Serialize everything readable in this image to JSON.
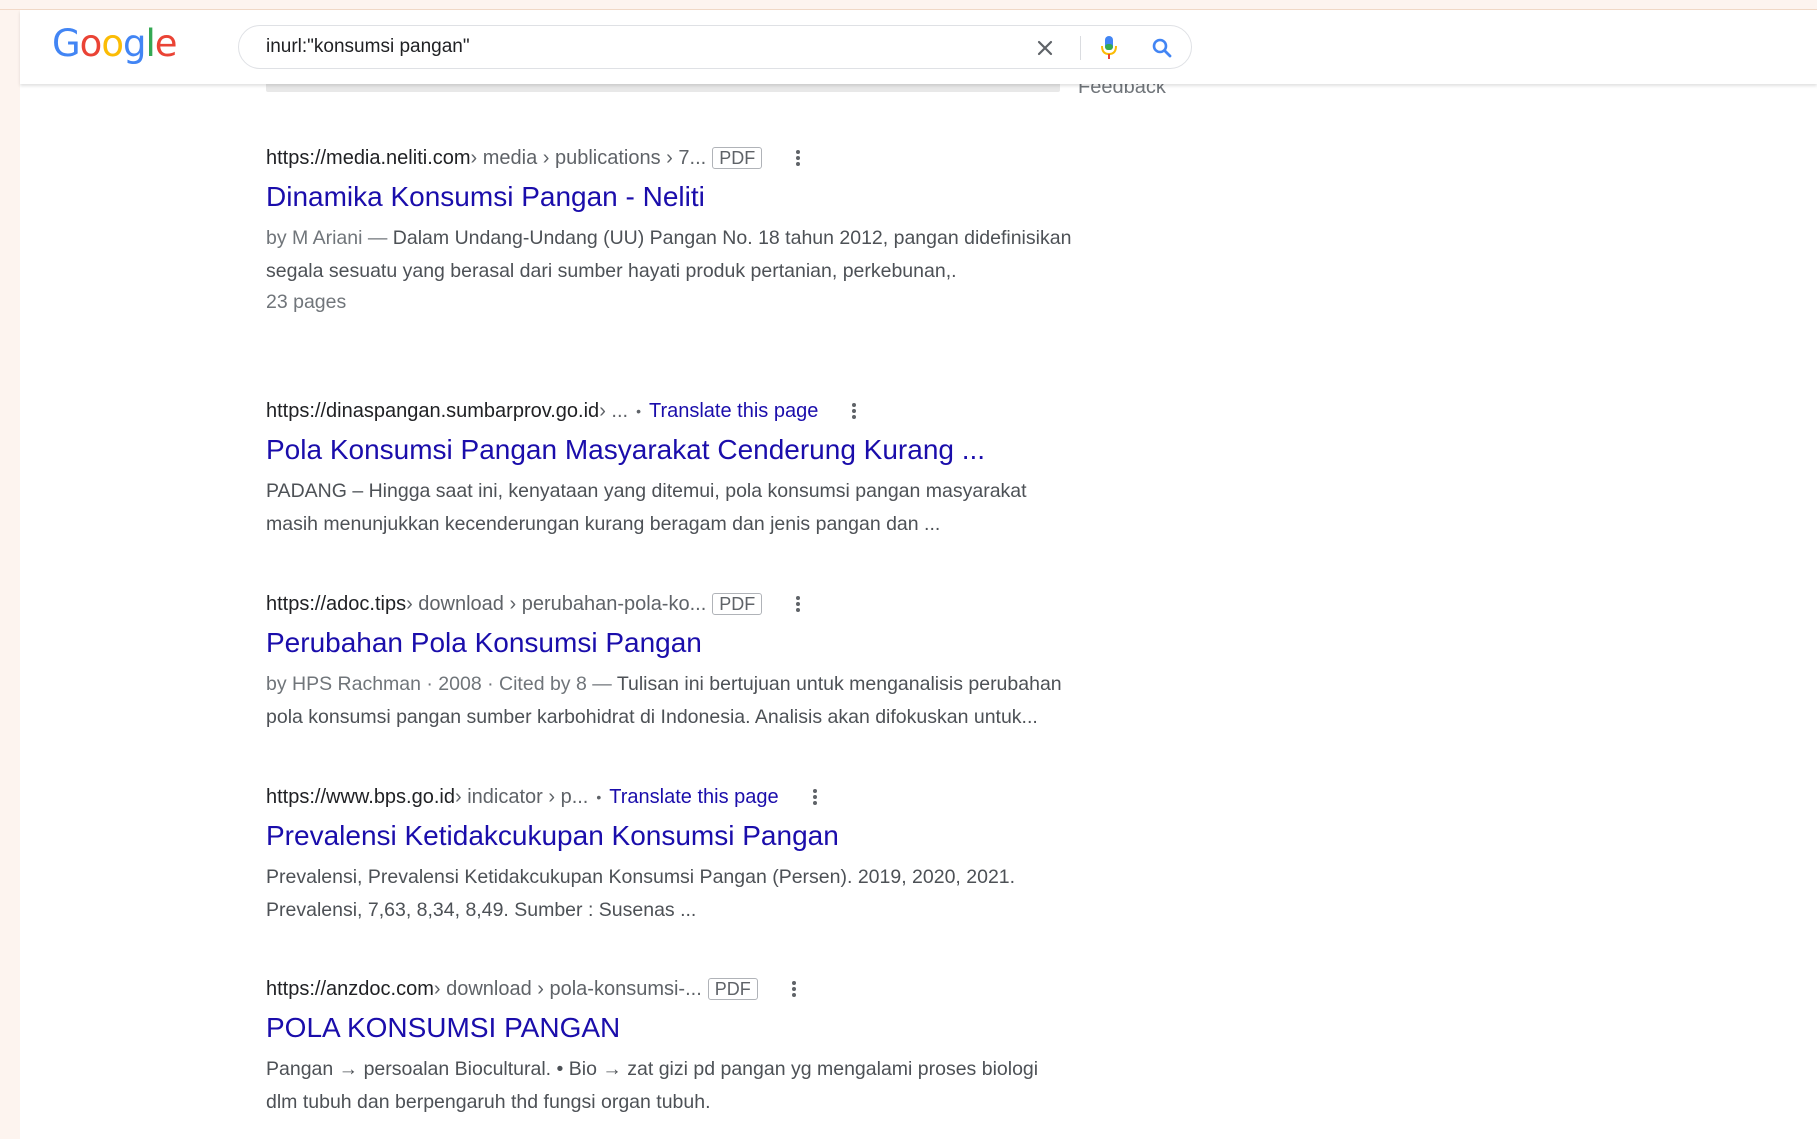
{
  "header": {
    "logo_letters": [
      {
        "ch": "G",
        "color": "#4285f4"
      },
      {
        "ch": "o",
        "color": "#ea4335"
      },
      {
        "ch": "o",
        "color": "#fbbc05"
      },
      {
        "ch": "g",
        "color": "#4285f4"
      },
      {
        "ch": "l",
        "color": "#34a853"
      },
      {
        "ch": "e",
        "color": "#ea4335"
      }
    ],
    "search_value": "inurl:\"konsumsi pangan\"",
    "icons": {
      "clear": "close-icon",
      "mic": "mic-icon",
      "search": "search-icon"
    }
  },
  "feedback_label": "Feedback",
  "results": [
    {
      "site": "https://media.neliti.com",
      "path": " › media › publications › 7...",
      "pdf": "PDF",
      "title": "Dinamika Konsumsi Pangan - Neliti",
      "meta": "by M Ariani — ",
      "snippet1": "Dalam Undang-Undang (UU) Pangan No. 18 tahun 2012, pangan didefinisikan",
      "snippet2": "segala sesuatu yang berasal dari sumber hayati produk pertanian, perkebunan,.",
      "extra": "23 pages"
    },
    {
      "site": "https://dinaspangan.sumbarprov.go.id",
      "path": " › ...",
      "translate": "Translate this page",
      "title": "Pola Konsumsi Pangan Masyarakat Cenderung Kurang ...",
      "snippet1": "PADANG – Hingga saat ini, kenyataan yang ditemui, pola konsumsi pangan masyarakat",
      "snippet2": "masih menunjukkan kecenderungan kurang beragam dan jenis pangan dan ..."
    },
    {
      "site": "https://adoc.tips",
      "path": " › download › perubahan-pola-ko...",
      "pdf": "PDF",
      "title": "Perubahan Pola Konsumsi Pangan",
      "meta": "by HPS Rachman · 2008 · Cited by 8 — ",
      "snippet1": "Tulisan ini bertujuan untuk menganalisis perubahan",
      "snippet2": "pola konsumsi pangan sumber karbohidrat di Indonesia. Analisis akan difokuskan untuk..."
    },
    {
      "site": "https://www.bps.go.id",
      "path": " › indicator › p...",
      "translate": "Translate this page",
      "title": "Prevalensi Ketidakcukupan Konsumsi Pangan",
      "snippet1": "Prevalensi, Prevalensi Ketidakcukupan Konsumsi Pangan (Persen). 2019, 2020, 2021.",
      "snippet2": "Prevalensi, 7,63, 8,34, 8,49. Sumber : Susenas ..."
    },
    {
      "site": "https://anzdoc.com",
      "path": " › download › pola-konsumsi-...",
      "pdf": "PDF",
      "title": "POLA KONSUMSI PANGAN",
      "snippet1": "Pangan → persoalan Biocultural. • Bio → zat gizi pd pangan yg mengalami proses biologi",
      "snippet2": "dlm tubuh dan berpengaruh thd fungsi organ tubuh."
    }
  ]
}
